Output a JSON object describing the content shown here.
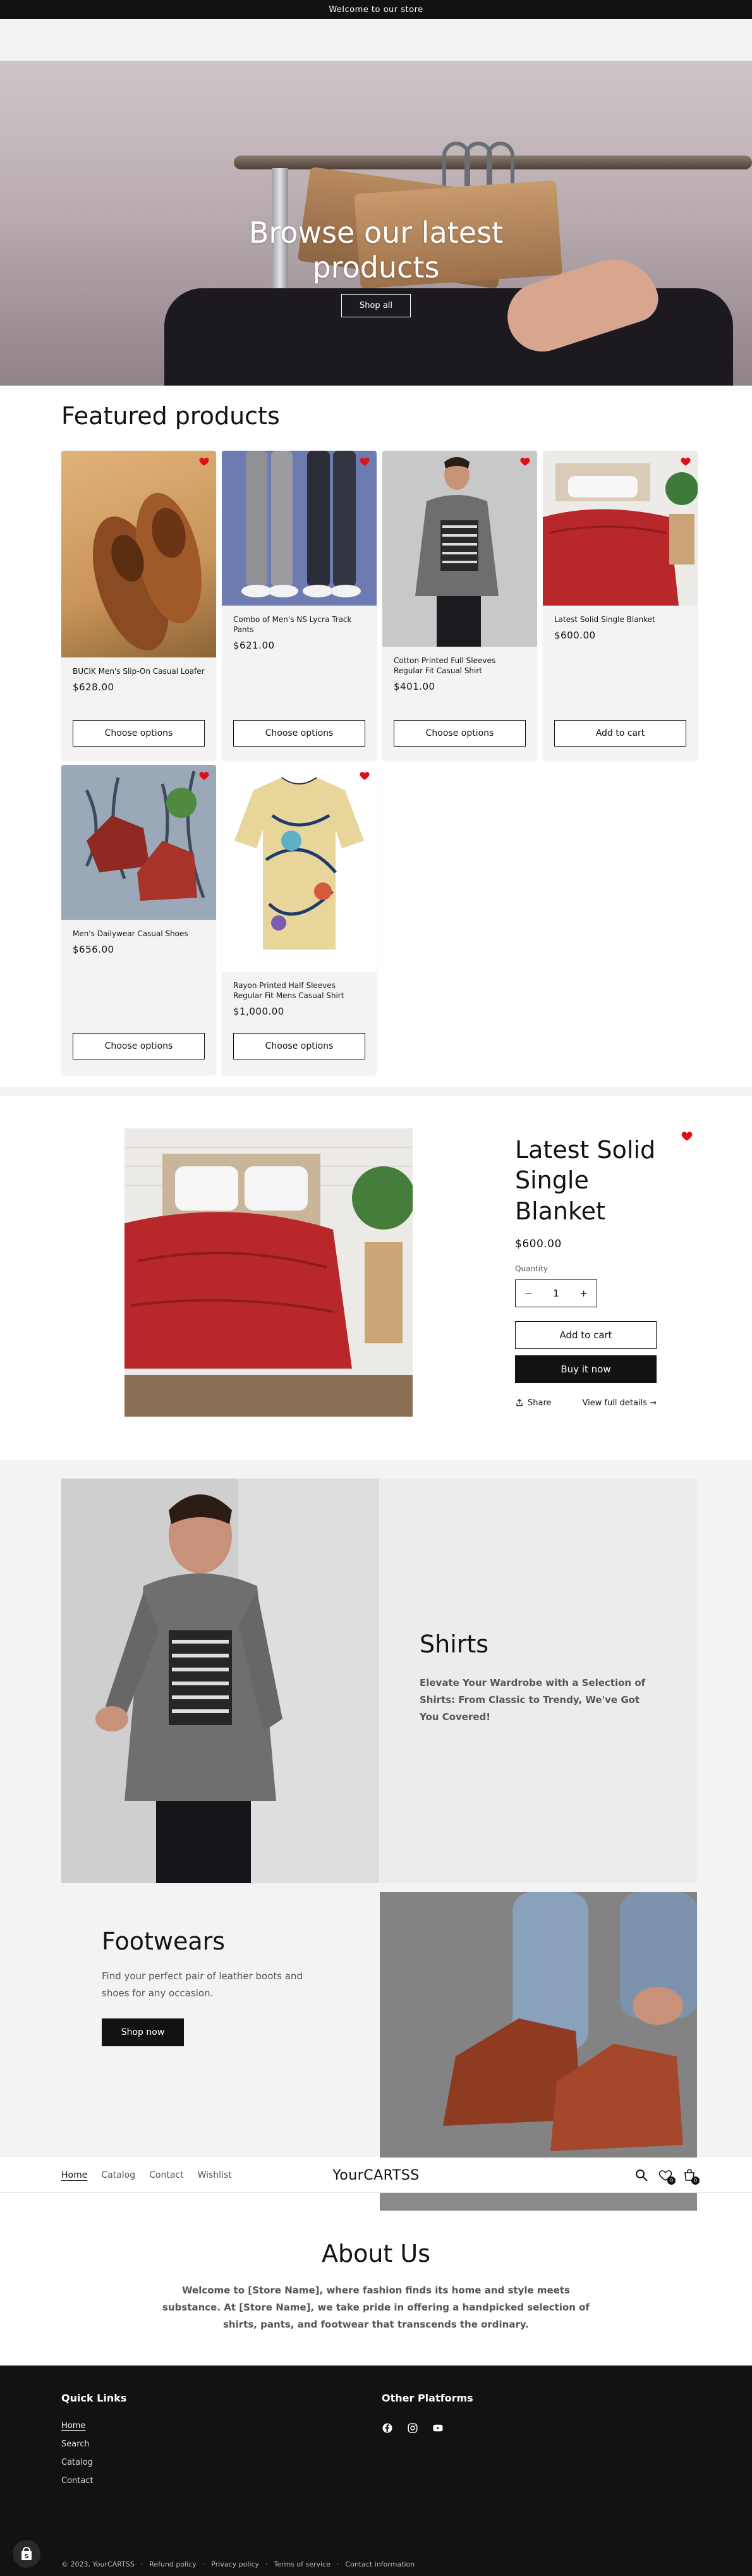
{
  "announcement": {
    "text": "Welcome to our store"
  },
  "hero": {
    "title": "Browse our latest products",
    "button_label": "Shop all"
  },
  "featured": {
    "title": "Featured products",
    "products": [
      {
        "title": "BUCIK Men's Slip-On Casual Loafer",
        "price": "$628.00",
        "button": "Choose options"
      },
      {
        "title": "Combo of Men's NS Lycra Track Pants",
        "price": "$621.00",
        "button": "Choose options"
      },
      {
        "title": "Cotton Printed Full Sleeves Regular Fit Casual Shirt",
        "price": "$401.00",
        "button": "Choose options"
      },
      {
        "title": "Latest Solid Single Blanket",
        "price": "$600.00",
        "button": "Add to cart"
      },
      {
        "title": "Men's Dailywear Casual Shoes",
        "price": "$656.00",
        "button": "Choose options"
      },
      {
        "title": "Rayon Printed Half Sleeves Regular Fit Mens Casual Shirt",
        "price": "$1,000.00",
        "button": "Choose options"
      }
    ]
  },
  "featured_product": {
    "title": "Latest Solid Single Blanket",
    "price": "$600.00",
    "quantity_label": "Quantity",
    "quantity": "1",
    "minus": "−",
    "plus": "+",
    "add_to_cart": "Add to cart",
    "buy_now": "Buy it now",
    "share": "Share",
    "view_details": "View full details →"
  },
  "shirts": {
    "title": "Shirts",
    "text": "Elevate Your Wardrobe with a Selection of Shirts: From Classic to Trendy, We've Got You Covered!"
  },
  "footwears": {
    "title": "Footwears",
    "text": "Find your perfect pair of leather boots and shoes for any occasion.",
    "button": "Shop now"
  },
  "header": {
    "nav": [
      "Home",
      "Catalog",
      "Contact",
      "Wishlist"
    ],
    "logo": "YourCARTSS",
    "wishlist_count": "0",
    "cart_count": "0"
  },
  "about": {
    "title": "About Us",
    "text": "Welcome to [Store Name], where fashion finds its home and style meets substance. At [Store Name], we take pride in offering a handpicked selection of shirts, pants, and footwear that transcends the ordinary."
  },
  "footer": {
    "quick_links_title": "Quick Links",
    "quick_links": [
      "Home",
      "Search",
      "Catalog",
      "Contact"
    ],
    "platforms_title": "Other Platforms",
    "copyright": "© 2023, YourCARTSS",
    "policies": [
      "Refund policy",
      "Privacy policy",
      "Terms of service",
      "Contact information"
    ]
  },
  "colors": {
    "accent": "#121212",
    "heart": "#e0101b",
    "background_alt": "#f3f3f3"
  },
  "icons": [
    "heart-icon",
    "share-icon",
    "search-icon",
    "wishlist-icon",
    "cart-icon",
    "facebook-icon",
    "instagram-icon",
    "youtube-icon",
    "shop-pay-icon"
  ]
}
